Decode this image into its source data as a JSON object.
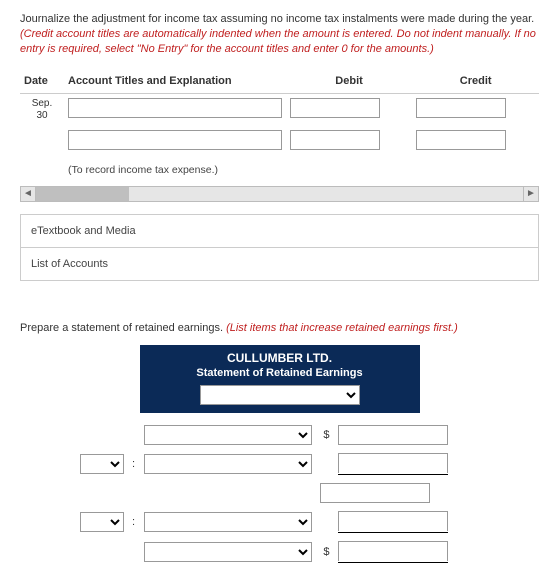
{
  "q1": {
    "intro": "Journalize the adjustment for income tax assuming no income tax instalments were made during the year.",
    "hint": "(Credit account titles are automatically indented when the amount is entered. Do not indent manually. If no entry is required, select \"No Entry\" for the account titles and enter 0 for the amounts.)",
    "headers": {
      "date": "Date",
      "acct": "Account Titles and Explanation",
      "debit": "Debit",
      "credit": "Credit"
    },
    "date_month": "Sep.",
    "date_day": "30",
    "caption": "(To record income tax expense.)"
  },
  "links": {
    "etext": "eTextbook and Media",
    "loa": "List of Accounts"
  },
  "q2": {
    "intro": "Prepare a statement of retained earnings.",
    "hint": "(List items that increase retained earnings first.)",
    "company": "CULLUMBER LTD.",
    "title": "Statement of Retained Earnings",
    "dollar": "$",
    "colon": ":"
  }
}
